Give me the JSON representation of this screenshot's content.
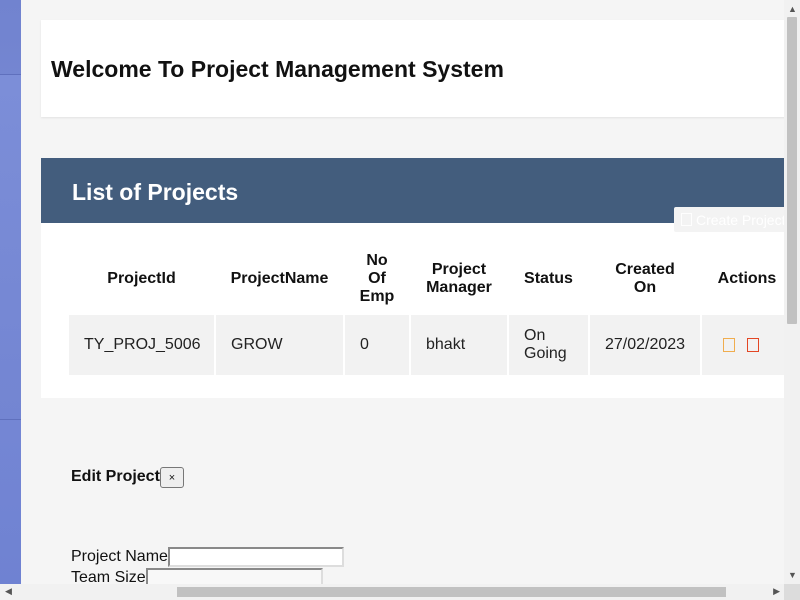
{
  "header": {
    "title": "Welcome To Project Management System"
  },
  "projects": {
    "title": "List of Projects",
    "create_label": "Create Project",
    "columns": [
      "ProjectId",
      "ProjectName",
      "No Of Emp",
      "Project Manager",
      "Status",
      "Created On",
      "Actions"
    ],
    "rows": [
      {
        "id": "TY_PROJ_5006",
        "name": "GROW",
        "emp": "0",
        "manager": "bhakt",
        "status": "On Going",
        "created": "27/02/2023"
      }
    ]
  },
  "edit_form": {
    "title": "Edit Project",
    "close_label": "×",
    "project_name_label": "Project Name",
    "team_size_label": "Team Size"
  },
  "colors": {
    "header_bar": "#435d7d",
    "edit_icon": "#f0ad4e",
    "delete_icon": "#e34724"
  }
}
